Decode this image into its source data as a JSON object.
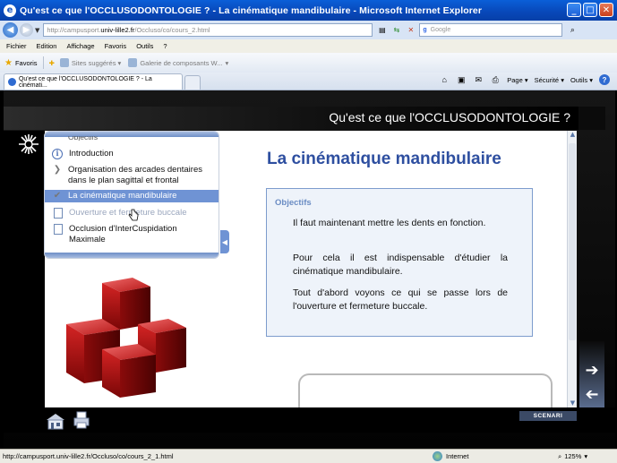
{
  "window": {
    "title": "Qu'est ce que l'OCCLUSODONTOLOGIE ? - La cinématique mandibulaire - Microsoft Internet Explorer",
    "buttons": {
      "minimize": "_",
      "maximize": "□",
      "close": "✕"
    }
  },
  "address": {
    "url_prefix": "http://campusport.",
    "url_host": "univ-lille2.fr",
    "url_path": "/Occluso/co/cours_2.html",
    "search_engine": "Google",
    "search_placeholder": "Google"
  },
  "menu": [
    "Fichier",
    "Edition",
    "Affichage",
    "Favoris",
    "Outils",
    "?"
  ],
  "favorites": {
    "label": "Favoris",
    "links": [
      "Sites suggérés ▾",
      "Galerie de composants W..."
    ]
  },
  "tab": {
    "label": "Qu'est ce que l'OCCLUSODONTOLOGIE ? - La cinémati..."
  },
  "commands": {
    "page": "Page ▾",
    "security": "Sécurité ▾",
    "tools": "Outils ▾"
  },
  "course": {
    "header_title": "Qu'est ce que l'OCCLUSODONTOLOGIE ?",
    "outline": {
      "cut_item": "Objectifs",
      "items": [
        {
          "label": "Introduction",
          "icon": "info-icon"
        },
        {
          "label": "Organisation des arcades dentaires dans le plan sagittal et frontal",
          "icon": "chevron-right-icon"
        },
        {
          "label": "La cinématique mandibulaire",
          "icon": "chevron-down-icon"
        },
        {
          "label": "Ouverture et fermeture buccale",
          "icon": "document-icon"
        },
        {
          "label": "Occlusion d'InterCuspidation Maximale",
          "icon": "document-icon"
        }
      ]
    },
    "page_title": "La cinématique mandibulaire",
    "objectives": {
      "label": "Objectifs",
      "paragraphs": [
        "Il faut maintenant mettre les dents en fonction.",
        "Pour cela il est indispensable d'étudier la cinématique mandibulaire.",
        "Tout d'abord voyons ce qui se passe lors de l'ouverture et fermeture buccale."
      ]
    },
    "footer_brand": "SCENARI"
  },
  "status": {
    "url": "http://campusport.univ-lille2.fr/Occluso/co/cours_2_1.html",
    "zone": "Internet",
    "zoom": "125%"
  },
  "colors": {
    "accent": "#2e4fa0",
    "outline_active": "#6f93d4",
    "titlebar": "#0a5fd8"
  }
}
